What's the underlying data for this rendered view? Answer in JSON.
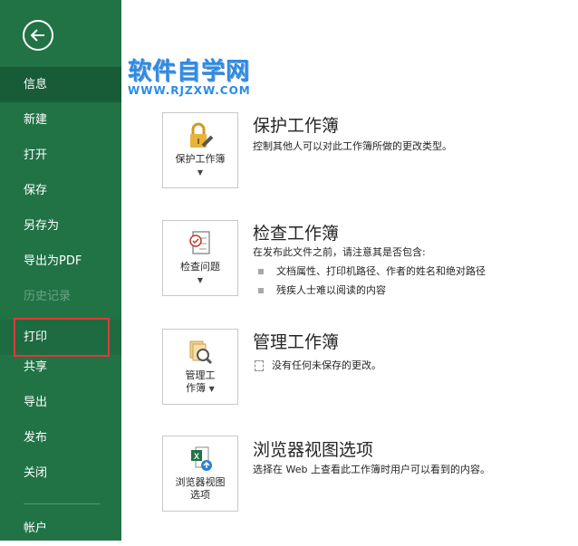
{
  "sidebar": {
    "items": [
      {
        "label": "信息",
        "state": "active"
      },
      {
        "label": "新建",
        "state": "normal"
      },
      {
        "label": "打开",
        "state": "normal"
      },
      {
        "label": "保存",
        "state": "normal"
      },
      {
        "label": "另存为",
        "state": "normal"
      },
      {
        "label": "导出为PDF",
        "state": "normal"
      },
      {
        "label": "历史记录",
        "state": "disabled"
      },
      {
        "label": "打印",
        "state": "hover"
      },
      {
        "label": "共享",
        "state": "normal"
      },
      {
        "label": "导出",
        "state": "normal"
      },
      {
        "label": "发布",
        "state": "normal"
      },
      {
        "label": "关闭",
        "state": "normal"
      },
      {
        "label": "帐户",
        "state": "normal"
      }
    ]
  },
  "watermark": {
    "title": "软件自学网",
    "url": "WWW.RJZXW.COM"
  },
  "sections": {
    "protect": {
      "button_label": "保护工作簿",
      "title": "保护工作簿",
      "desc": "控制其他人可以对此工作簿所做的更改类型。"
    },
    "inspect": {
      "button_label": "检查问题",
      "title": "检查工作簿",
      "desc": "在发布此文件之前，请注意其是否包含:",
      "bullets": [
        "文档属性、打印机路径、作者的姓名和绝对路径",
        "残疾人士难以阅读的内容"
      ]
    },
    "manage": {
      "button_line1": "管理工",
      "button_line2": "作簿",
      "title": "管理工作簿",
      "desc": "没有任何未保存的更改。"
    },
    "browser": {
      "button_line1": "浏览器视图",
      "button_line2": "选项",
      "title": "浏览器视图选项",
      "desc": "选择在 Web 上查看此工作簿时用户可以看到的内容。"
    }
  },
  "colors": {
    "sidebar": "#217346",
    "active": "#185c37",
    "highlight": "#e03a3a",
    "watermark": "#2b8be6"
  }
}
